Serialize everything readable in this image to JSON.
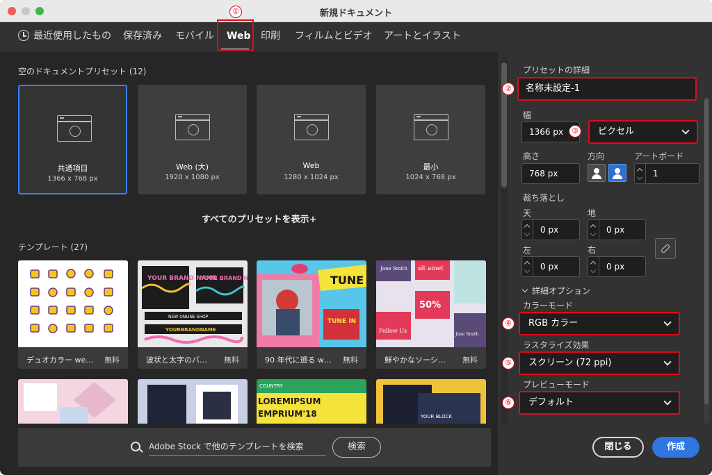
{
  "window": {
    "title": "新規ドキュメント"
  },
  "tabs": [
    {
      "label": "最近使用したもの",
      "icon": "clock-icon"
    },
    {
      "label": "保存済み"
    },
    {
      "label": "モバイル"
    },
    {
      "label": "Web",
      "active": true
    },
    {
      "label": "印刷"
    },
    {
      "label": "フィルムとビデオ"
    },
    {
      "label": "アートとイラスト"
    }
  ],
  "presets": {
    "heading": "空のドキュメントプリセット",
    "count": "(12)",
    "items": [
      {
        "name": "共通項目",
        "size": "1366 x 768 px",
        "selected": true
      },
      {
        "name": "Web (大)",
        "size": "1920 x 1080 px"
      },
      {
        "name": "Web",
        "size": "1280 x 1024 px"
      },
      {
        "name": "最小",
        "size": "1024 x 768 px"
      }
    ],
    "show_all": "すべてのプリセットを表示+"
  },
  "templates": {
    "heading": "テンプレート",
    "count": "(27)",
    "items": [
      {
        "name": "デュオカラー web…",
        "badge": "無料"
      },
      {
        "name": "波状と太字のバナ…",
        "badge": "無料"
      },
      {
        "name": "90 年代に遡る web…",
        "badge": "無料"
      },
      {
        "name": "鮮やかなソーシャ…",
        "badge": "無料"
      }
    ],
    "thumb_text": {
      "t2_brand": "YOUR BRAND NAME",
      "t2_shop": "NEW ONLINE SHOP",
      "t2_bottom": "YOURBRANDNAME",
      "t3_tune": "TUNE",
      "t3_tune2": "TUNE IN",
      "t4_name": "Jane Smith",
      "t4_sit": "sit amet",
      "t4_pct": "50%",
      "t4_follow": "Follow Us",
      "t4_jane2": "Jane Smith",
      "r2_lorem": "LOREMIPSUM",
      "r2_emp": "EMPRIUM'18",
      "r2_country": "COUNTRY",
      "r2_your": "YOUR BLOCK"
    }
  },
  "search": {
    "placeholder": "Adobe Stock で他のテンプレートを検索",
    "button": "検索"
  },
  "details": {
    "heading": "プリセットの詳細",
    "name": "名称未設定-1",
    "width_label": "幅",
    "width": "1366 px",
    "unit": "ピクセル",
    "height_label": "高さ",
    "height": "768 px",
    "orientation_label": "方向",
    "artboard_label": "アートボード",
    "artboard_count": "1",
    "bleed_label": "裁ち落とし",
    "bleed": {
      "top_label": "天",
      "top": "0 px",
      "bottom_label": "地",
      "bottom": "0 px",
      "left_label": "左",
      "left": "0 px",
      "right_label": "右",
      "right": "0 px"
    },
    "advanced_label": "詳細オプション",
    "color_mode_label": "カラーモード",
    "color_mode": "RGB カラー",
    "raster_label": "ラスタライズ効果",
    "raster": "スクリーン (72 ppi)",
    "preview_label": "プレビューモード",
    "preview": "デフォルト"
  },
  "actions": {
    "close": "閉じる",
    "create": "作成"
  },
  "annotations": [
    "①",
    "②",
    "③",
    "④",
    "⑤",
    "⑥"
  ],
  "colors": {
    "accent": "#2f76e0",
    "highlight": "#e0091b",
    "panel": "#262626"
  }
}
